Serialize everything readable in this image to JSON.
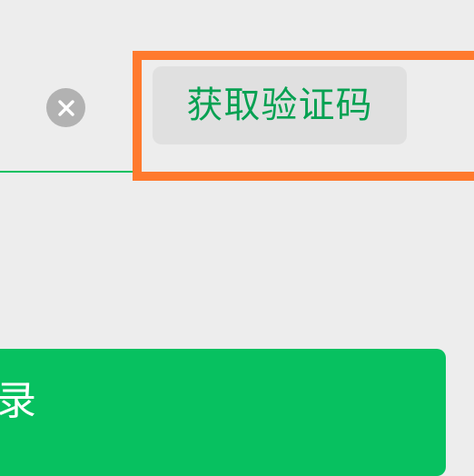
{
  "verify_form": {
    "clear_icon": "close-circle-icon",
    "get_code_label": "获取验证码",
    "login_label_partial": "录"
  },
  "colors": {
    "accent_green": "#07c160",
    "code_text": "#07a152",
    "highlight": "#ff7a2e",
    "background": "#ededed"
  }
}
